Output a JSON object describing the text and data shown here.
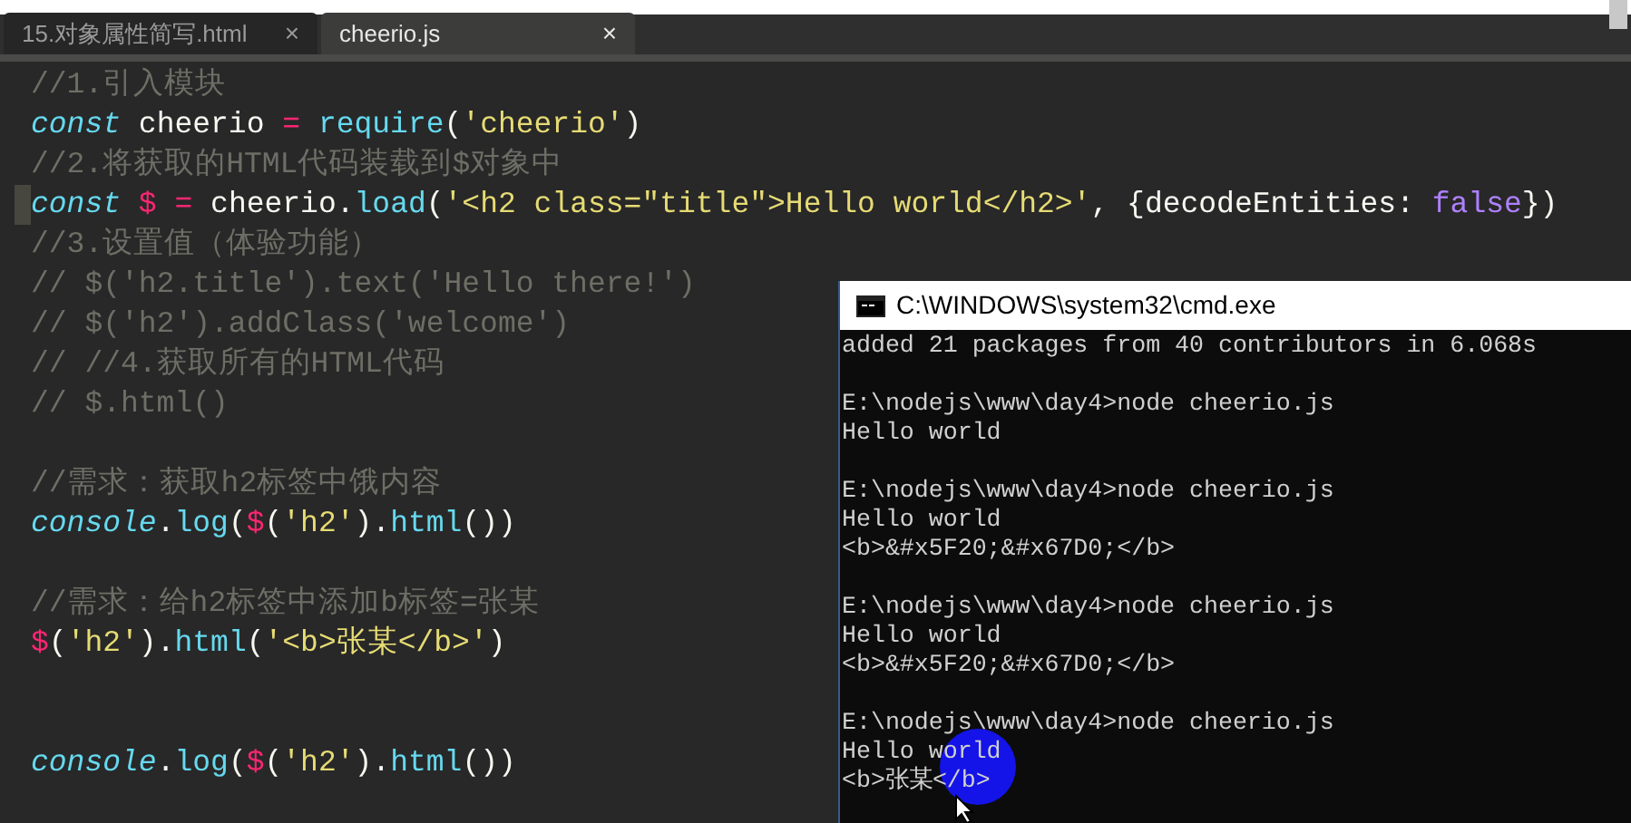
{
  "tabs": [
    {
      "label": "15.对象属性简写.html",
      "selected": false,
      "close": "×"
    },
    {
      "label": "cheerio.js",
      "selected": true,
      "close": "×"
    }
  ],
  "editor": {
    "lines": [
      {
        "kind": "code",
        "current": false,
        "tokens": [
          {
            "kind": "comment",
            "text": "//1.引入模块"
          }
        ]
      },
      {
        "kind": "code",
        "current": false,
        "tokens": [
          {
            "kind": "keyword",
            "text": "const"
          },
          {
            "kind": "plain",
            "text": " cheerio "
          },
          {
            "kind": "op",
            "text": "= "
          },
          {
            "kind": "func",
            "text": "require"
          },
          {
            "kind": "plain",
            "text": "("
          },
          {
            "kind": "string",
            "text": "'cheerio'"
          },
          {
            "kind": "plain",
            "text": ")"
          }
        ]
      },
      {
        "kind": "code",
        "current": false,
        "tokens": [
          {
            "kind": "comment",
            "text": "//2.将获取的HTML代码装载到$对象中"
          }
        ]
      },
      {
        "kind": "code",
        "current": true,
        "tokens": [
          {
            "kind": "keyword",
            "text": "const "
          },
          {
            "kind": "op",
            "text": "$ ="
          },
          {
            "kind": "plain",
            "text": " cheerio."
          },
          {
            "kind": "func",
            "text": "load"
          },
          {
            "kind": "plain",
            "text": "("
          },
          {
            "kind": "string",
            "text": "'<h2 class=\"title\">Hello world</h2>'"
          },
          {
            "kind": "plain",
            "text": ", {decodeEntities: "
          },
          {
            "kind": "boolean",
            "text": "false"
          },
          {
            "kind": "plain",
            "text": "})"
          }
        ]
      },
      {
        "kind": "code",
        "current": false,
        "tokens": [
          {
            "kind": "comment",
            "text": "//3.设置值（体验功能）"
          }
        ]
      },
      {
        "kind": "code",
        "current": false,
        "tokens": [
          {
            "kind": "comment",
            "text": "// $('h2.title').text('Hello there!')"
          }
        ]
      },
      {
        "kind": "code",
        "current": false,
        "tokens": [
          {
            "kind": "comment",
            "text": "// $('h2').addClass('welcome')"
          }
        ]
      },
      {
        "kind": "code",
        "current": false,
        "tokens": [
          {
            "kind": "comment",
            "text": "// //4.获取所有的HTML代码"
          }
        ]
      },
      {
        "kind": "code",
        "current": false,
        "tokens": [
          {
            "kind": "comment",
            "text": "// $.html()"
          }
        ]
      },
      {
        "kind": "blank"
      },
      {
        "kind": "code",
        "current": false,
        "tokens": [
          {
            "kind": "comment",
            "text": "//需求：获取h2标签中饿内容"
          }
        ]
      },
      {
        "kind": "code",
        "current": false,
        "tokens": [
          {
            "kind": "keyword",
            "text": "console"
          },
          {
            "kind": "plain",
            "text": "."
          },
          {
            "kind": "func",
            "text": "log"
          },
          {
            "kind": "plain",
            "text": "("
          },
          {
            "kind": "op",
            "text": "$"
          },
          {
            "kind": "plain",
            "text": "("
          },
          {
            "kind": "string",
            "text": "'h2'"
          },
          {
            "kind": "plain",
            "text": ")."
          },
          {
            "kind": "func",
            "text": "html"
          },
          {
            "kind": "plain",
            "text": "())"
          }
        ]
      },
      {
        "kind": "blank"
      },
      {
        "kind": "code",
        "current": false,
        "tokens": [
          {
            "kind": "comment",
            "text": "//需求：给h2标签中添加b标签=张某"
          }
        ]
      },
      {
        "kind": "code",
        "current": false,
        "tokens": [
          {
            "kind": "op",
            "text": "$"
          },
          {
            "kind": "plain",
            "text": "("
          },
          {
            "kind": "string",
            "text": "'h2'"
          },
          {
            "kind": "plain",
            "text": ")."
          },
          {
            "kind": "func",
            "text": "html"
          },
          {
            "kind": "plain",
            "text": "("
          },
          {
            "kind": "string",
            "text": "'<b>张某</b>'"
          },
          {
            "kind": "plain",
            "text": ")"
          }
        ]
      },
      {
        "kind": "blank"
      },
      {
        "kind": "blank"
      },
      {
        "kind": "code",
        "current": false,
        "tokens": [
          {
            "kind": "keyword",
            "text": "console"
          },
          {
            "kind": "plain",
            "text": "."
          },
          {
            "kind": "func",
            "text": "log"
          },
          {
            "kind": "plain",
            "text": "("
          },
          {
            "kind": "op",
            "text": "$"
          },
          {
            "kind": "plain",
            "text": "("
          },
          {
            "kind": "string",
            "text": "'h2'"
          },
          {
            "kind": "plain",
            "text": ")."
          },
          {
            "kind": "func",
            "text": "html"
          },
          {
            "kind": "plain",
            "text": "())"
          }
        ]
      }
    ]
  },
  "console_window": {
    "title": "C:\\WINDOWS\\system32\\cmd.exe",
    "blocks": [
      [
        "added 21 packages from 40 contributors in 6.068s"
      ],
      [
        "E:\\nodejs\\www\\day4>node cheerio.js",
        "Hello world"
      ],
      [
        "E:\\nodejs\\www\\day4>node cheerio.js",
        "Hello world",
        "<b>&#x5F20;&#x67D0;</b>"
      ],
      [
        "E:\\nodejs\\www\\day4>node cheerio.js",
        "Hello world",
        "<b>&#x5F20;&#x67D0;</b>"
      ],
      [
        "E:\\nodejs\\www\\day4>node cheerio.js",
        "Hello world",
        "<b>张某</b>"
      ]
    ]
  }
}
